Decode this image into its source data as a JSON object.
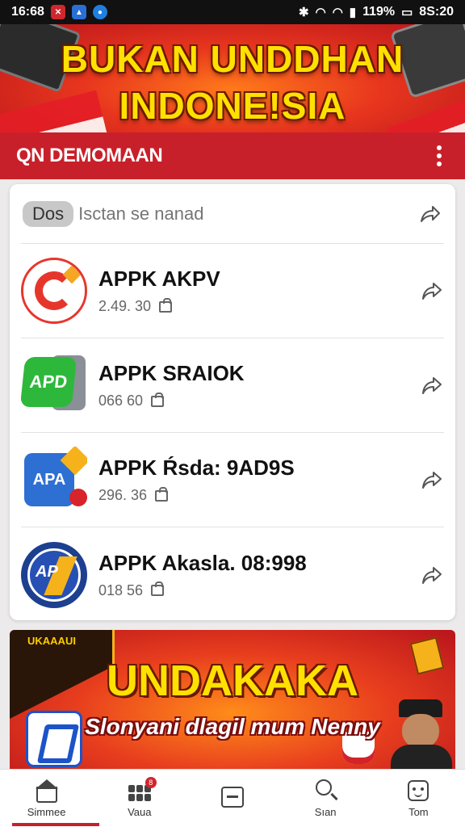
{
  "status_bar": {
    "time": "16:68",
    "notification_icons": [
      "red-app-icon",
      "photo-icon",
      "circle-app-icon"
    ],
    "battery": "119%",
    "clock_right": "8S:20",
    "system_icons": [
      "bluetooth-icon",
      "wifi-icon",
      "wifi-icon",
      "signal-icon"
    ]
  },
  "top_banner": {
    "line1": "BUKAN UNDDHAN",
    "line2": "INDONE!SIA"
  },
  "app_header": {
    "title": "QN DEMOMAAN",
    "menu_icon": "more-vertical-icon"
  },
  "search": {
    "tag": "Dos",
    "placeholder": "Isctan se nanad"
  },
  "apps": [
    {
      "name": "APPK AKPV",
      "meta": "2.49. 30",
      "icon": "red-circle-app-icon"
    },
    {
      "name": "APPK SRAIOK",
      "meta": "066 60",
      "icon": "green-chat-app-icon"
    },
    {
      "name": "APPK Ŕsda: 9AD9S",
      "meta": "296. 36",
      "icon": "blue-apk-app-icon"
    },
    {
      "name": "APPK Akasla. 08:998",
      "meta": "018 56",
      "icon": "navy-round-app-icon"
    }
  ],
  "bottom_banner": {
    "corner_text": "UKAAAUI",
    "title": "UNDAKAKA",
    "subtitle": "Slonyani dlagil mum Nenny"
  },
  "bottom_nav": [
    {
      "label": "Simmee",
      "icon": "home-icon",
      "active": true
    },
    {
      "label": "Vaua",
      "icon": "grid-icon",
      "badge": "8"
    },
    {
      "label": "",
      "icon": "square-icon"
    },
    {
      "label": "Sıan",
      "icon": "search-icon"
    },
    {
      "label": "Tom",
      "icon": "profile-icon"
    }
  ],
  "colors": {
    "header_red": "#c8202a",
    "title_yellow": "#ffe000",
    "banner_orange": "#ff7a1a"
  }
}
